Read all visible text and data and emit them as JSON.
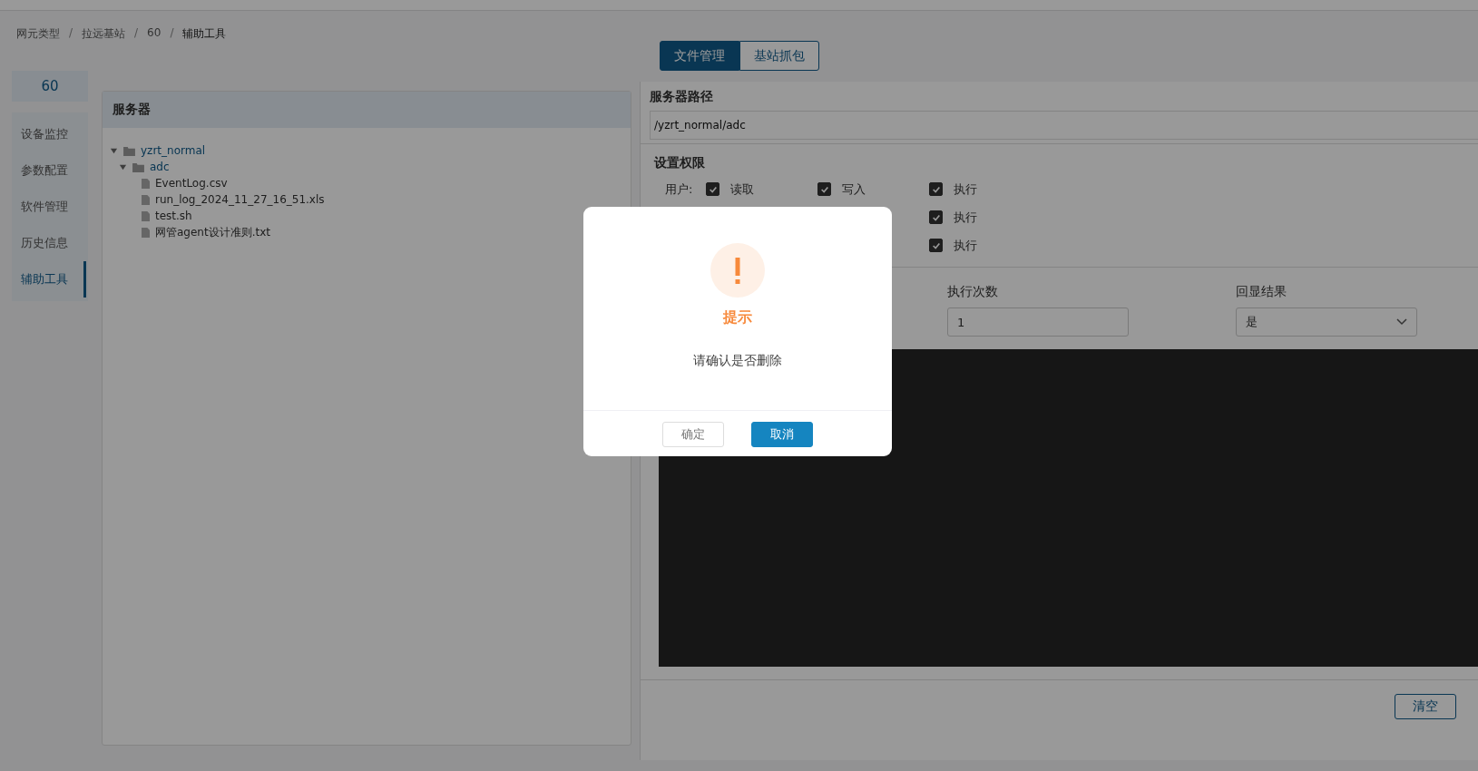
{
  "breadcrumb": {
    "separator": "/",
    "items": [
      "网元类型",
      "拉远基站",
      "60",
      "辅助工具"
    ]
  },
  "view_tabs": [
    {
      "label": "文件管理",
      "selected": true
    },
    {
      "label": "基站抓包",
      "selected": false
    }
  ],
  "sidebar": {
    "title": "60",
    "items": [
      {
        "label": "设备监控",
        "selected": false
      },
      {
        "label": "参数配置",
        "selected": false
      },
      {
        "label": "软件管理",
        "selected": false
      },
      {
        "label": "历史信息",
        "selected": false
      },
      {
        "label": "辅助工具",
        "selected": true
      }
    ]
  },
  "server_panel": {
    "title": "服务器",
    "tree": [
      {
        "label": "yzrt_normal",
        "kind": "folder",
        "expanded": true,
        "children": [
          {
            "label": "adc",
            "kind": "folder",
            "expanded": true,
            "children": [
              {
                "label": "EventLog.csv",
                "kind": "file"
              },
              {
                "label": "run_log_2024_11_27_16_51.xls",
                "kind": "file"
              },
              {
                "label": "test.sh",
                "kind": "file"
              },
              {
                "label": "网管agent设计准则.txt",
                "kind": "file"
              }
            ]
          }
        ]
      }
    ]
  },
  "path": {
    "label": "服务器路径",
    "value": "/yzrt_normal/adc"
  },
  "permissions": {
    "title": "设置权限",
    "rows": [
      {
        "label": "用户:",
        "read": {
          "label": "读取",
          "checked": true
        },
        "write": {
          "label": "写入",
          "checked": true
        },
        "execute": {
          "label": "执行",
          "checked": true
        }
      },
      {
        "execute": {
          "label": "执行",
          "checked": true
        }
      },
      {
        "execute": {
          "label": "执行",
          "checked": true
        }
      }
    ]
  },
  "fields": [
    {
      "label": "执行次数",
      "kind": "input",
      "value": "1"
    },
    {
      "label": "回显结果",
      "kind": "select",
      "value": "是"
    }
  ],
  "clear_button": "清空",
  "dialog": {
    "title": "提示",
    "message": "请确认是否删除",
    "buttons": [
      {
        "label": "确定",
        "kind": "plain"
      },
      {
        "label": "取消",
        "kind": "primary"
      }
    ]
  }
}
